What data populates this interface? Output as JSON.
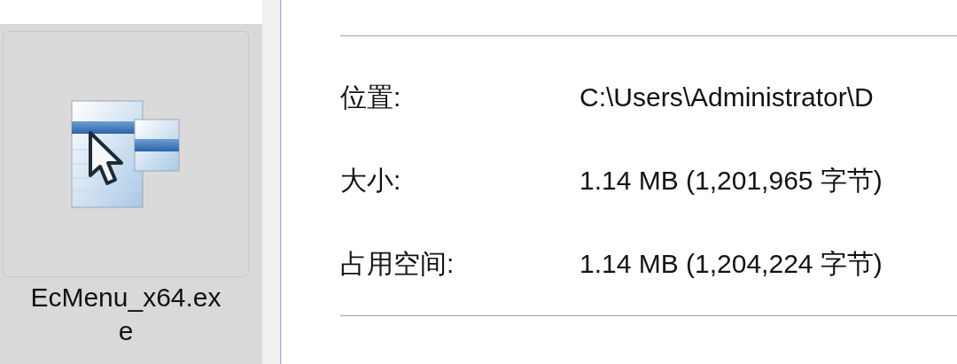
{
  "file": {
    "name": "EcMenu_x64.exe",
    "selected": true
  },
  "properties": [
    {
      "label": "位置:",
      "value": "C:\\Users\\Administrator\\D"
    },
    {
      "label": "大小:",
      "value": "1.14 MB (1,201,965 字节)"
    },
    {
      "label": "占用空间:",
      "value": "1.14 MB (1,204,224 字节)"
    }
  ]
}
